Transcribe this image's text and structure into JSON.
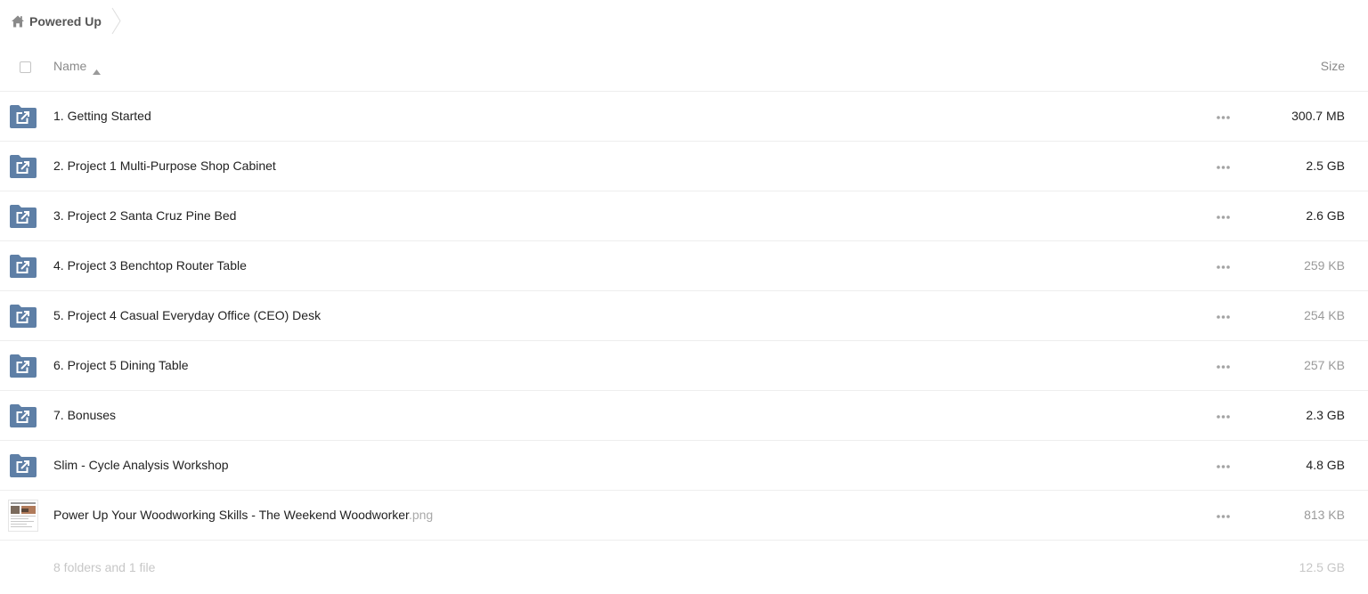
{
  "breadcrumb": {
    "home_label": "Powered Up"
  },
  "header": {
    "name_label": "Name",
    "size_label": "Size"
  },
  "colors": {
    "folder": "#5e7fa6",
    "text": "#222222",
    "muted": "#9a9a9a"
  },
  "files": [
    {
      "name": "1. Getting Started",
      "ext": "",
      "size": "300.7 MB",
      "type": "shared-folder",
      "muted": false
    },
    {
      "name": "2. Project 1 Multi-Purpose Shop Cabinet",
      "ext": "",
      "size": "2.5 GB",
      "type": "shared-folder",
      "muted": false
    },
    {
      "name": "3. Project 2 Santa Cruz Pine Bed",
      "ext": "",
      "size": "2.6 GB",
      "type": "shared-folder",
      "muted": false
    },
    {
      "name": "4. Project 3 Benchtop Router Table",
      "ext": "",
      "size": "259 KB",
      "type": "shared-folder",
      "muted": true
    },
    {
      "name": "5. Project 4 Casual Everyday Office (CEO) Desk",
      "ext": "",
      "size": "254 KB",
      "type": "shared-folder",
      "muted": true
    },
    {
      "name": "6. Project 5 Dining Table",
      "ext": "",
      "size": "257 KB",
      "type": "shared-folder",
      "muted": true
    },
    {
      "name": "7. Bonuses",
      "ext": "",
      "size": "2.3 GB",
      "type": "shared-folder",
      "muted": false
    },
    {
      "name": "Slim - Cycle Analysis Workshop",
      "ext": "",
      "size": "4.8 GB",
      "type": "shared-folder",
      "muted": false
    },
    {
      "name": "Power Up Your Woodworking Skills - The Weekend Woodworker",
      "ext": ".png",
      "size": "813 KB",
      "type": "image",
      "muted": true
    }
  ],
  "summary": {
    "count_label": "8 folders and 1 file",
    "total_size": "12.5 GB"
  }
}
